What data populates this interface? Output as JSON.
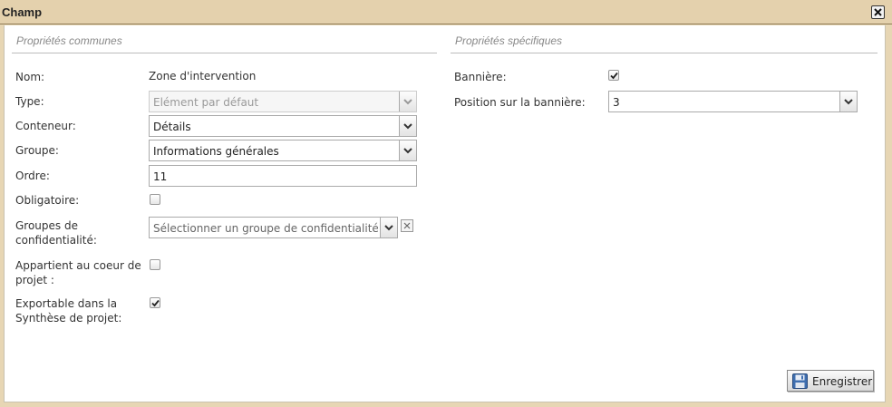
{
  "window": {
    "title": "Champ"
  },
  "common": {
    "title": "Propriétés communes",
    "nom": {
      "label": "Nom:",
      "value": "Zone d'intervention"
    },
    "type": {
      "label": "Type:",
      "value": "Elément par défaut"
    },
    "conteneur": {
      "label": "Conteneur:",
      "value": "Détails"
    },
    "groupe": {
      "label": "Groupe:",
      "value": "Informations générales"
    },
    "ordre": {
      "label": "Ordre:",
      "value": "11"
    },
    "obligatoire": {
      "label": "Obligatoire:",
      "checked": false
    },
    "confidentialite": {
      "label_line1": "Groupes de",
      "label_line2": "confidentialité:",
      "placeholder": "Sélectionner un groupe de confidentialité..."
    },
    "coeur": {
      "label_line1": "Appartient au coeur de",
      "label_line2": "projet :",
      "checked": false
    },
    "exportable": {
      "label_line1": "Exportable dans la",
      "label_line2": "Synthèse de projet:",
      "checked": true
    }
  },
  "specific": {
    "title": "Propriétés spécifiques",
    "banniere": {
      "label": "Bannière:",
      "checked": true
    },
    "position": {
      "label": "Position sur la bannière:",
      "value": "3"
    }
  },
  "actions": {
    "save_label": "Enregistrer",
    "save_icon": "floppy-disk-icon"
  }
}
